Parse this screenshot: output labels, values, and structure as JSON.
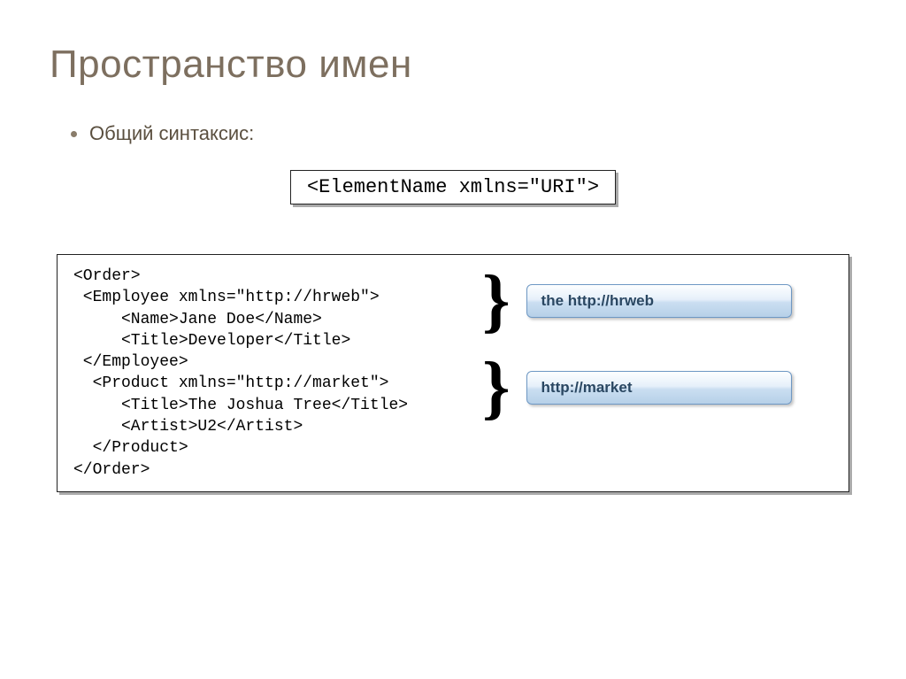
{
  "slide": {
    "title": "Пространство имен",
    "bullet": "Общий синтаксис:",
    "syntax": "<ElementName xmlns=\"URI\">",
    "code": "<Order>\n <Employee xmlns=\"http://hrweb\">\n     <Name>Jane Doe</Name>\n     <Title>Developer</Title>\n </Employee>\n  <Product xmlns=\"http://market\">\n     <Title>The Joshua Tree</Title>\n     <Artist>U2</Artist>\n  </Product>\n</Order>",
    "annotation1": "the http://hrweb",
    "annotation2": "http://market",
    "brace": "}"
  }
}
